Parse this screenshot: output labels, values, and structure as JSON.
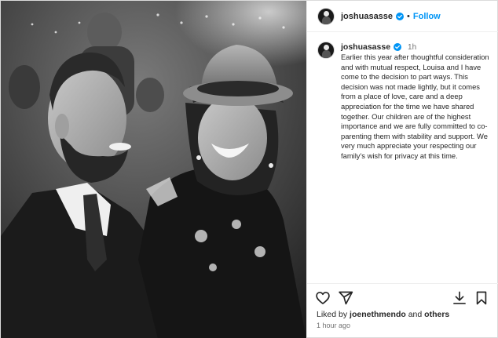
{
  "post": {
    "username": "joshuasasse",
    "follow_label": "Follow",
    "separator": "•",
    "caption_time": "1h",
    "caption_text": "Earlier this year after thoughtful consideration and with mutual respect, Louisa and I have come to the decision to part ways. This decision was not made lightly, but it comes from a place of love, care and a deep appreciation for the time we have shared together. Our children are of the highest importance and we are fully committed to co-parenting them with stability and support. We very much appreciate your respecting our family's wish for privacy at this time.",
    "likes_prefix": "Liked by ",
    "likes_user": "joenethmendo",
    "likes_and": " and ",
    "likes_others": "others",
    "timestamp": "1 hour ago"
  },
  "icons": {
    "verified": "verified-badge-icon",
    "like": "heart-icon",
    "share": "send-icon",
    "download": "download-icon",
    "save": "bookmark-icon"
  },
  "colors": {
    "follow": "#0095f6",
    "verified": "#0095f6",
    "muted": "#737373"
  }
}
